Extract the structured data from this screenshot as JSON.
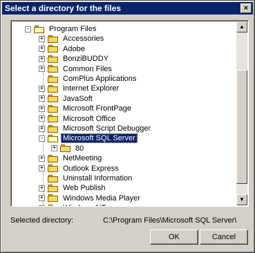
{
  "window": {
    "title": "Select a directory for the files",
    "close_label": "×"
  },
  "tree": {
    "root": {
      "label": "Program Files"
    },
    "items": [
      {
        "label": "Accessories",
        "expander": "+"
      },
      {
        "label": "Adobe",
        "expander": "+"
      },
      {
        "label": "BonziBUDDY",
        "expander": "+"
      },
      {
        "label": "Common Files",
        "expander": "+"
      },
      {
        "label": "ComPlus Applications",
        "expander": ""
      },
      {
        "label": "Internet Explorer",
        "expander": "+"
      },
      {
        "label": "JavaSoft",
        "expander": "+"
      },
      {
        "label": "Microsoft FrontPage",
        "expander": "+"
      },
      {
        "label": "Microsoft Office",
        "expander": "+"
      },
      {
        "label": "Microsoft Script Debugger",
        "expander": "+"
      },
      {
        "label": "Microsoft SQL Server",
        "expander": "-",
        "selected": true
      },
      {
        "label": "80",
        "expander": "+",
        "child": true
      },
      {
        "label": "NetMeeting",
        "expander": "+"
      },
      {
        "label": "Outlook Express",
        "expander": "+"
      },
      {
        "label": "Uninstall Information",
        "expander": ""
      },
      {
        "label": "Web Publish",
        "expander": "+"
      },
      {
        "label": "Windows Media Player",
        "expander": "+"
      },
      {
        "label": "Windows NT",
        "expander": "+"
      }
    ]
  },
  "selected": {
    "label": "Selected directory:",
    "path": "C:\\Program Files\\Microsoft SQL Server\\"
  },
  "buttons": {
    "ok": "OK",
    "cancel": "Cancel"
  },
  "scrollbar": {
    "up": "▲",
    "down": "▼"
  }
}
